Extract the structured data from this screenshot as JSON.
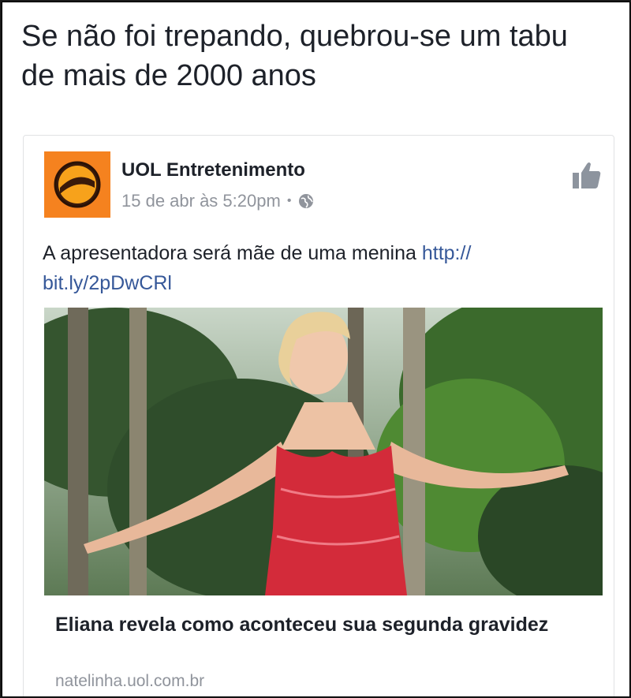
{
  "caption": "Se não foi trepando, quebrou-se um tabu de mais de 2000 anos",
  "post": {
    "page_name": "UOL Entretenimento",
    "timestamp": "15 de abr às 5:20pm",
    "separator": "•",
    "privacy_icon": "globe-icon",
    "action_icon": "thumbs-up-icon",
    "text": "A apresentadora será mãe de uma menina",
    "link_url_text": "http://\nbit.ly/2pDwCRl",
    "logo_color": "#f5821f"
  },
  "link_preview": {
    "title": "Eliana revela como aconteceu sua segunda gravidez",
    "domain": "natelinha.uol.com.br",
    "image_description_icon": "photo-woman-red-dress"
  },
  "colors": {
    "text": "#1d2129",
    "secondary": "#90949c",
    "link": "#365899",
    "dress": "#d32b3a"
  }
}
